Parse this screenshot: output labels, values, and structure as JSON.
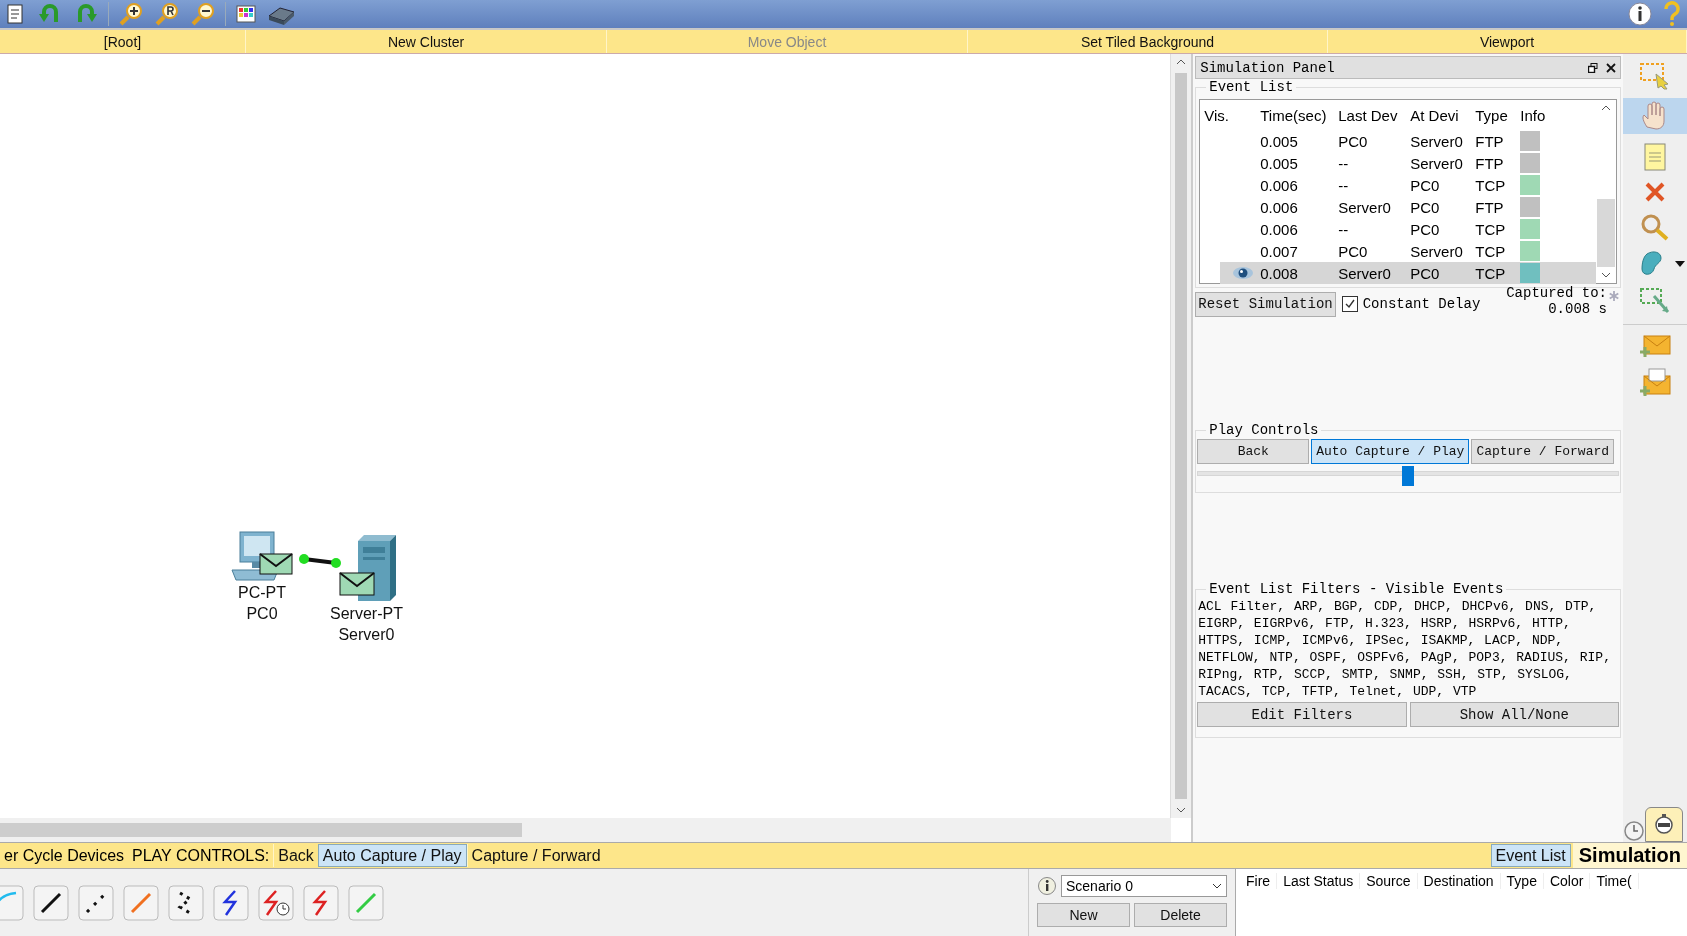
{
  "nav_bar": [
    {
      "label": "[Root]",
      "disabled": false
    },
    {
      "label": "New Cluster",
      "disabled": false
    },
    {
      "label": "Move Object",
      "disabled": true
    },
    {
      "label": "Set Tiled Background",
      "disabled": false
    },
    {
      "label": "Viewport",
      "disabled": false
    }
  ],
  "workspace": {
    "devices": [
      {
        "kind": "pc",
        "model": "PC-PT",
        "name": "PC0"
      },
      {
        "kind": "server",
        "model": "Server-PT",
        "name": "Server0"
      }
    ]
  },
  "simulation_panel": {
    "title": "Simulation Panel",
    "event_list": {
      "title": "Event List",
      "columns": [
        "Vis.",
        "Time(sec)",
        "Last Dev",
        "At Devi",
        "Type",
        "Info"
      ],
      "rows": [
        {
          "time": "0.005",
          "last_device": "PC0",
          "at_device": "Server0",
          "type": "FTP",
          "color": "#c0c0c0",
          "selected": false
        },
        {
          "time": "0.005",
          "last_device": "--",
          "at_device": "Server0",
          "type": "FTP",
          "color": "#c0c0c0",
          "selected": false
        },
        {
          "time": "0.006",
          "last_device": "--",
          "at_device": "PC0",
          "type": "TCP",
          "color": "#9fd9b4",
          "selected": false
        },
        {
          "time": "0.006",
          "last_device": "Server0",
          "at_device": "PC0",
          "type": "FTP",
          "color": "#c0c0c0",
          "selected": false
        },
        {
          "time": "0.006",
          "last_device": "--",
          "at_device": "PC0",
          "type": "TCP",
          "color": "#9fd9b4",
          "selected": false
        },
        {
          "time": "0.007",
          "last_device": "PC0",
          "at_device": "Server0",
          "type": "TCP",
          "color": "#9fd9b4",
          "selected": false
        },
        {
          "time": "0.008",
          "last_device": "Server0",
          "at_device": "PC0",
          "type": "TCP",
          "color": "#70bfbf",
          "selected": true
        }
      ]
    },
    "reset_button": "Reset Simulation",
    "constant_delay": {
      "label": "Constant Delay",
      "checked": true
    },
    "captured_label": "Captured to:",
    "captured_value": "0.008 s",
    "play_controls": {
      "title": "Play Controls",
      "buttons": [
        {
          "label": "Back",
          "selected": false
        },
        {
          "label": "Auto Capture / Play",
          "selected": true
        },
        {
          "label": "Capture / Forward",
          "selected": false
        }
      ],
      "speed": {
        "level": 0.5
      }
    },
    "filters": {
      "title": "Event List Filters - Visible Events",
      "text": "ACL Filter, ARP, BGP, CDP, DHCP, DHCPv6, DNS, DTP, EIGRP, EIGRPv6, FTP, H.323, HSRP, HSRPv6, HTTP, HTTPS, ICMP, ICMPv6, IPSec, ISAKMP, LACP, NDP, NETFLOW, NTP, OSPF, OSPFv6, PAgP, POP3, RADIUS, RIP, RIPng, RTP, SCCP, SMTP, SNMP, SSH, STP, SYSLOG, TACACS, TCP, TFTP, Telnet, UDP, VTP",
      "buttons": [
        "Edit Filters",
        "Show All/None"
      ]
    }
  },
  "bottom_bar": {
    "label": "er Cycle Devices",
    "play_controls_label": "PLAY CONTROLS:",
    "buttons": [
      {
        "label": "Back",
        "selected": false
      },
      {
        "label": "Auto Capture / Play",
        "selected": true
      },
      {
        "label": "Capture / Forward",
        "selected": false
      }
    ],
    "event_list_button": {
      "label": "Event List",
      "selected": true
    },
    "mode": "Simulation"
  },
  "scenario": {
    "value": "Scenario 0",
    "buttons": [
      "New",
      "Delete"
    ]
  },
  "pdu_table": {
    "columns": [
      "Fire",
      "Last Status",
      "Source",
      "Destination",
      "Type",
      "Color",
      "Time("
    ]
  }
}
